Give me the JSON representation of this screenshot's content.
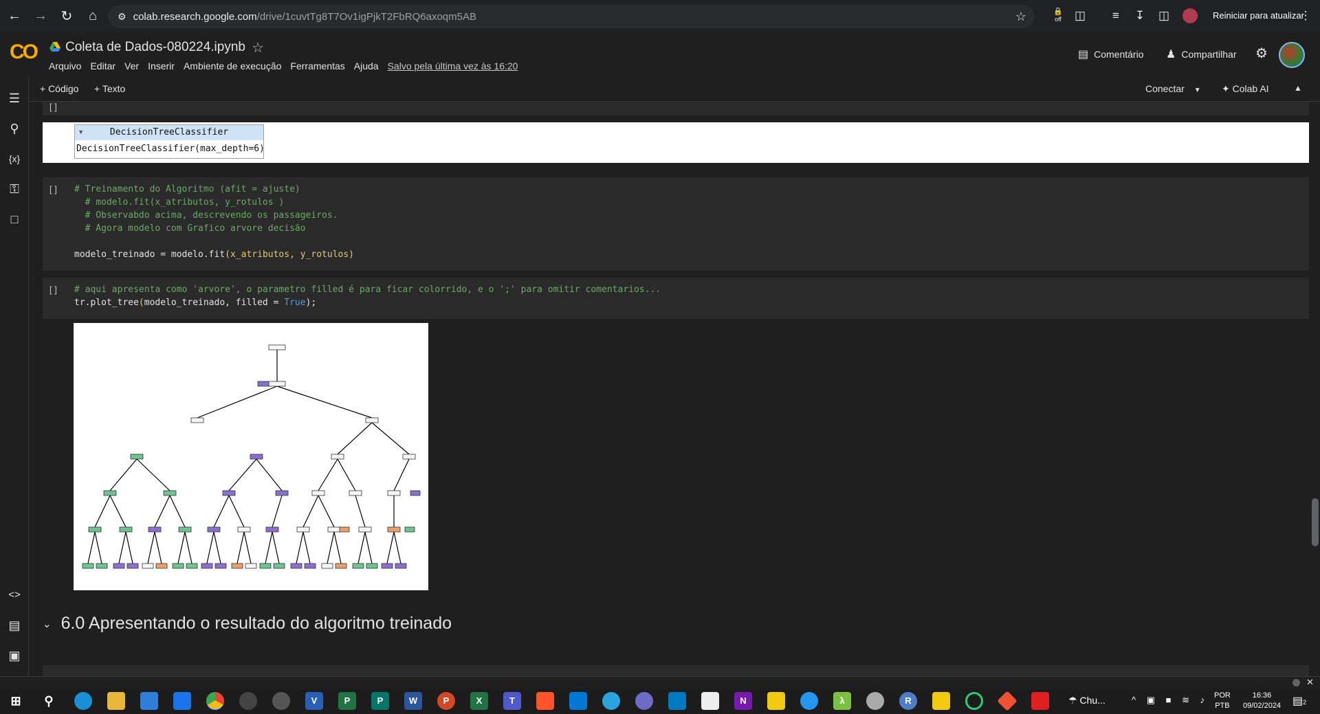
{
  "browser": {
    "url_host": "colab.research.google.com",
    "url_path": "/drive/1cuvtTg8T7Ov1igPjkT2FbRQ6axoqm5AB",
    "update_button": "Reiniciar para atualizar",
    "ext_off_label": "off"
  },
  "colab": {
    "logo": "CO",
    "title": "Coleta de Dados-080224.ipynb",
    "menu": [
      "Arquivo",
      "Editar",
      "Ver",
      "Inserir",
      "Ambiente de execução",
      "Ferramentas",
      "Ajuda"
    ],
    "saved_status": "Salvo pela última vez às 16:20",
    "comment_label": "Comentário",
    "share_label": "Compartilhar"
  },
  "toolbar": {
    "add_code": "+ Código",
    "add_text": "+ Texto",
    "connect": "Conectar",
    "colab_ai": "Colab AI"
  },
  "cells": {
    "bracket": "[ ]",
    "output_estimator": {
      "name": "DecisionTreeClassifier",
      "repr": "DecisionTreeClassifier(max_depth=6)"
    },
    "training_cell": {
      "line1": "# Treinamento do Algoritmo (afit = ajuste)",
      "line2": "  # modelo.fit(x_atributos, y_rotulos )",
      "line3": "  # Observabdo acima, descrevendo os passageiros.",
      "line4": "  # Agora modelo com Grafico arvore decisão",
      "line5_a": "modelo_treinado = modelo.fit",
      "line5_b": "(x_atributos, y_rotulos)"
    },
    "plot_cell": {
      "line1": "# aqui apresenta como 'arvore', o parametro filled é para ficar colorrido, e o ';' para omitir comentarios...",
      "line2_a": "tr.plot_tree",
      "line2_b": "(",
      "line2_c": "modelo_treinado, filled = ",
      "line2_d": "True",
      "line2_e": ");"
    }
  },
  "section_heading": "6.0 Apresentando o resultado do algoritmo treinado",
  "taskbar": {
    "weather": "Chu...",
    "lang_top": "POR",
    "lang_bottom": "PTB",
    "time": "16:36",
    "date": "09/02/2024",
    "notif_count": "2",
    "app_labels": [
      "V",
      "P",
      "P",
      "W",
      "P",
      "X",
      "T",
      "N",
      "λ",
      "R"
    ]
  },
  "colors": {
    "tree_green": "#6cc48e",
    "tree_purple": "#8a6fd1",
    "tree_orange": "#e8a06a",
    "code_comment": "#6aaa64"
  }
}
